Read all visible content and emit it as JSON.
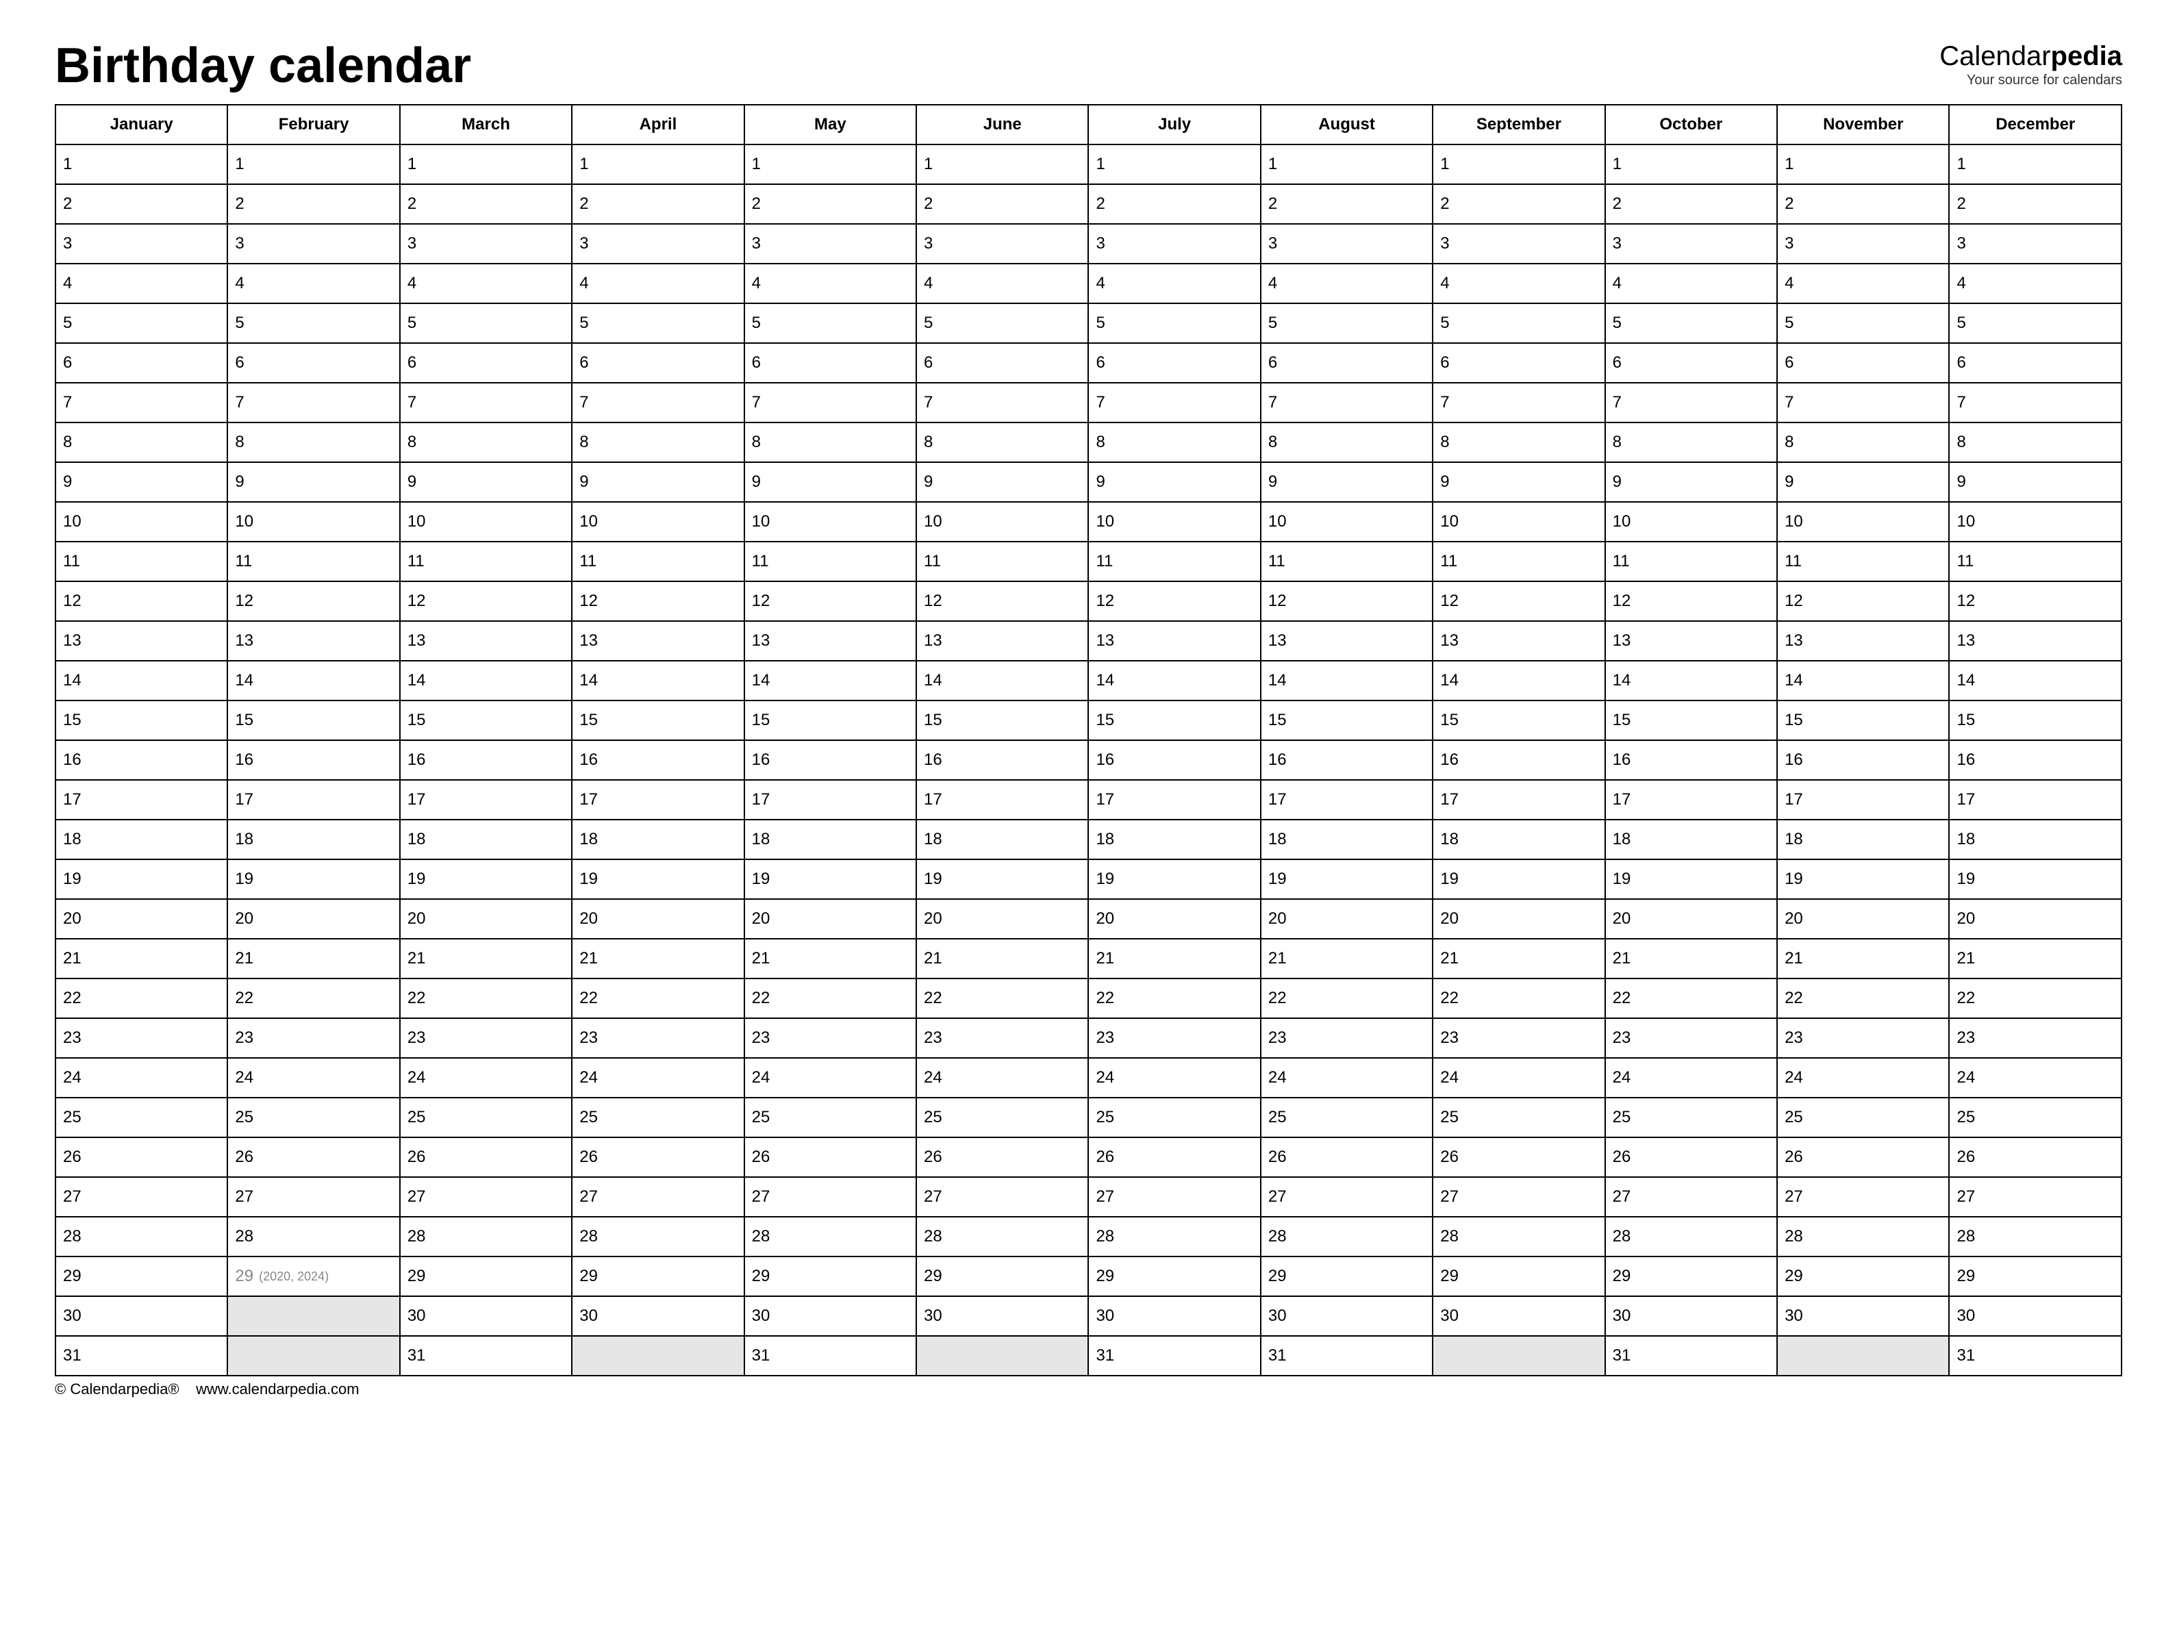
{
  "title": "Birthday calendar",
  "brand": {
    "name_prefix": "Calendar",
    "name_suffix": "pedia",
    "tagline": "Your source for calendars"
  },
  "months": [
    "January",
    "February",
    "March",
    "April",
    "May",
    "June",
    "July",
    "August",
    "September",
    "October",
    "November",
    "December"
  ],
  "month_lengths": [
    31,
    29,
    31,
    30,
    31,
    30,
    31,
    31,
    30,
    31,
    30,
    31
  ],
  "feb29_note": "(2020, 2024)",
  "footer": {
    "copyright": "© Calendarpedia®",
    "url": "www.calendarpedia.com"
  }
}
